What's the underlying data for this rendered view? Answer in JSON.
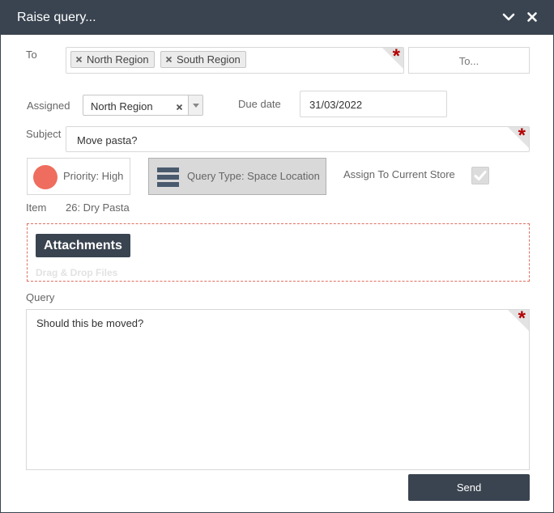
{
  "window": {
    "title": "Raise query..."
  },
  "to": {
    "label": "To",
    "tags": [
      "North Region",
      "South Region"
    ],
    "button_label": "To..."
  },
  "assigned": {
    "label": "Assigned",
    "value": "North Region"
  },
  "due_date": {
    "label": "Due date",
    "value": "31/03/2022"
  },
  "subject": {
    "label": "Subject",
    "value": "Move pasta?"
  },
  "priority": {
    "label": "Priority: High",
    "color": "#ef6d5e"
  },
  "query_type": {
    "label": "Query Type: Space Location"
  },
  "assign_current_store": {
    "label": "Assign To Current Store",
    "checked": true
  },
  "item": {
    "label": "Item",
    "value": "26: Dry Pasta"
  },
  "attachments": {
    "button_label": "Attachments",
    "hint": "Drag & Drop Files"
  },
  "query": {
    "label": "Query",
    "value": "Should this be moved?"
  },
  "send_label": "Send",
  "colors": {
    "header": "#3a4450",
    "required_star": "#b30000",
    "drop_border": "#e07060"
  },
  "icons": {
    "collapse": "chevron-down-icon",
    "close": "close-icon",
    "required": "asterisk",
    "query_type": "bars-icon",
    "check": "checkmark-icon"
  }
}
